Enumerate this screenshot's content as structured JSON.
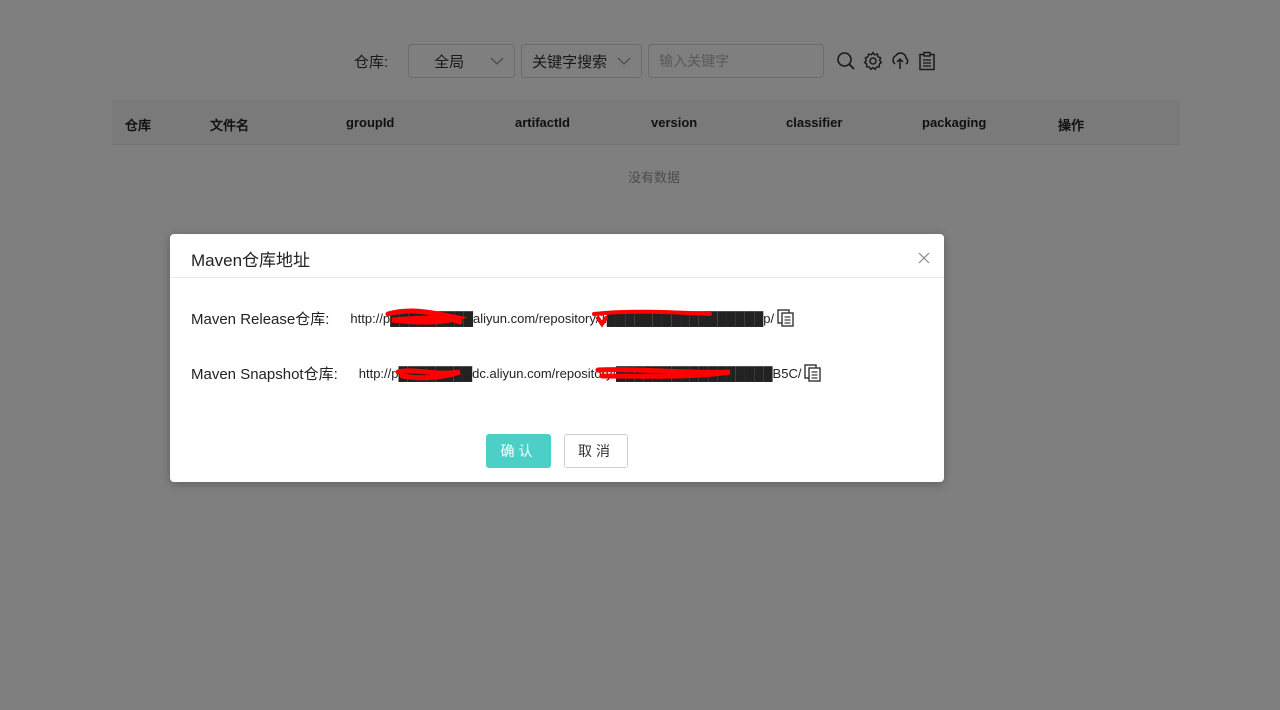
{
  "toolbar": {
    "repo_label": "仓库:",
    "scope_select_value": "全局",
    "search_mode_select_value": "关键字搜索",
    "keyword_placeholder": "输入关键字"
  },
  "table": {
    "columns": [
      "仓库",
      "文件名",
      "groupId",
      "artifactId",
      "version",
      "classifier",
      "packaging",
      "操作"
    ],
    "empty_text": "没有数据"
  },
  "modal": {
    "title": "Maven仓库地址",
    "release_label": "Maven Release仓库:",
    "release_url": "http://p█████████aliyun.com/repository/1█████████████████p/",
    "snapshot_label": "Maven Snapshot仓库:",
    "snapshot_url": "http://p████████dc.aliyun.com/repository/█████████████████B5C/",
    "ok_label": "确认",
    "cancel_label": "取消"
  },
  "colors": {
    "accent": "#4ccfc6",
    "redaction": "#ff0000",
    "overlay": "rgba(0,0,0,0.5)"
  }
}
